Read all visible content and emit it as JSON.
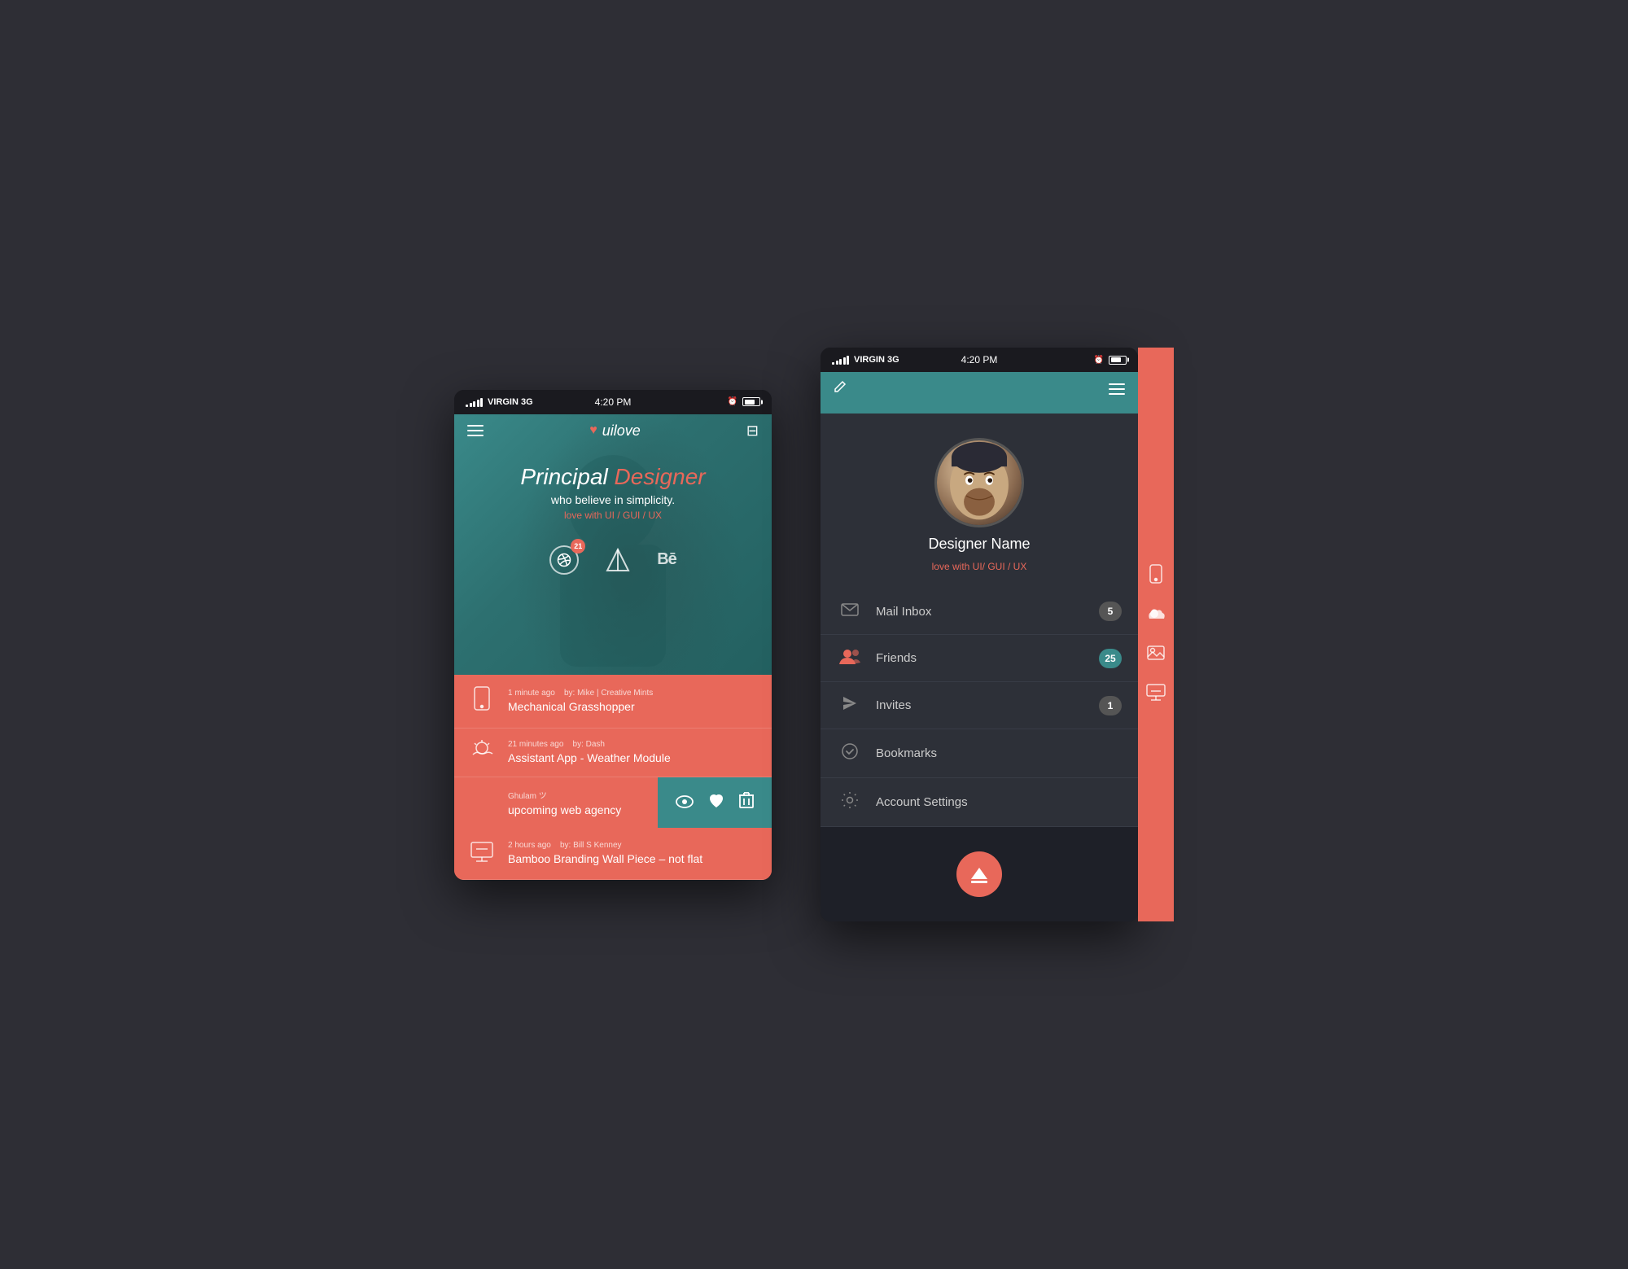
{
  "page": {
    "bg_color": "#2e2e35"
  },
  "status_bar": {
    "carrier": "VIRGIN  3G",
    "time": "4:20 PM",
    "signal_bars": [
      3,
      5,
      7,
      9,
      11
    ]
  },
  "phone1": {
    "brand": "uilove",
    "hero": {
      "title_normal": "Principal",
      "title_accent": "Designer",
      "sub1": "who believe in simplicity.",
      "sub2": "love with UI / GUI / UX"
    },
    "social": {
      "dribbble_badge": "21"
    },
    "feed": [
      {
        "time": "1 minute ago",
        "author": "by: Mike | Creative Mints",
        "title": "Mechanical Grasshopper",
        "icon": "📱"
      },
      {
        "time": "21 minutes ago",
        "author": "by: Dash",
        "title": "Assistant App - Weather Module",
        "icon": "⛅"
      },
      {
        "time": "",
        "author": "Ghulam ツ",
        "title": "upcoming web agency",
        "icon": ""
      },
      {
        "time": "2 hours ago",
        "author": "by: Bill S Kenney",
        "title": "Bamboo Branding Wall Piece – not flat",
        "icon": "🖥"
      }
    ]
  },
  "phone2": {
    "profile": {
      "name": "Designer Name",
      "sub": "love with UI/ GUI / UX"
    },
    "menu": [
      {
        "label": "Mail Inbox",
        "icon": "✉",
        "badge": "5",
        "badge_type": "gray"
      },
      {
        "label": "Friends",
        "icon": "👤",
        "badge": "25",
        "badge_type": "teal"
      },
      {
        "label": "Invites",
        "icon": "✈",
        "badge": "1",
        "badge_type": "gray"
      },
      {
        "label": "Bookmarks",
        "icon": "✔",
        "badge": "",
        "badge_type": ""
      },
      {
        "label": "Account Settings",
        "icon": "⚙",
        "badge": "",
        "badge_type": ""
      }
    ],
    "side_icons": [
      "📱",
      "⛅",
      "🖼",
      "🖥"
    ]
  }
}
